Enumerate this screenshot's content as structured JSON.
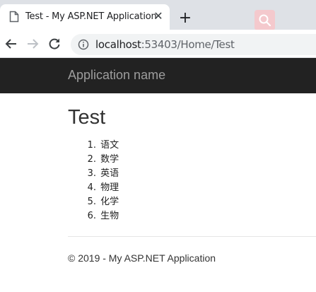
{
  "browser": {
    "tab_title": "Test - My ASP.NET Application",
    "tab_close_glyph": "✕",
    "new_tab_glyph": "+",
    "url_host": "localhost",
    "url_rest": ":53403/Home/Test",
    "icons": [
      "page-icon",
      "close-icon",
      "plus-icon",
      "search-icon",
      "back-arrow-icon",
      "forward-arrow-icon",
      "reload-icon",
      "info-icon"
    ]
  },
  "navbar": {
    "brand": "Application name"
  },
  "main": {
    "heading": "Test",
    "items": [
      {
        "num": "1.",
        "label": "语文"
      },
      {
        "num": "2.",
        "label": "数学"
      },
      {
        "num": "3.",
        "label": "英语"
      },
      {
        "num": "4.",
        "label": "物理"
      },
      {
        "num": "5.",
        "label": "化学"
      },
      {
        "num": "6.",
        "label": "生物"
      }
    ]
  },
  "footer": {
    "text": "© 2019 - My ASP.NET Application"
  },
  "colors": {
    "tabstrip_bg": "#dee1e6",
    "navbar_bg": "#222222",
    "brand_text": "#9d9d9d",
    "omnibox_bg": "#f1f3f4"
  }
}
